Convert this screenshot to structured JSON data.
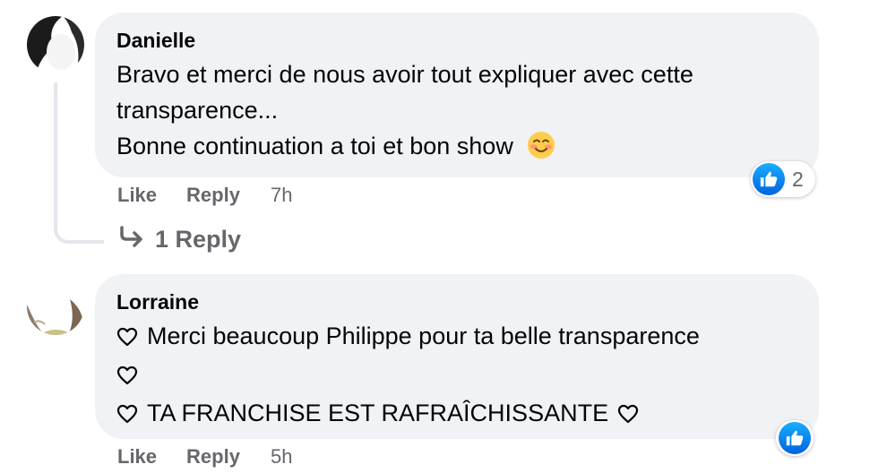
{
  "comments": [
    {
      "author": "Danielle",
      "lines": [
        "Bravo et merci de nous avoir tout expliquer avec cette",
        "transparence...",
        "Bonne continuation a toi et bon show"
      ],
      "emoji": "smiling-face-emoji",
      "like_label": "Like",
      "reply_label": "Reply",
      "time": "7h",
      "reaction_count": "2",
      "replies_label": "1 Reply"
    },
    {
      "author": "Lorraine",
      "lines": [
        "Merci beaucoup Philippe pour ta belle transparence",
        "",
        "TA FRANCHISE EST RAFRAÎCHISSANTE"
      ],
      "like_label": "Like",
      "reply_label": "Reply",
      "time": "5h"
    }
  ],
  "colors": {
    "bubble": "#f0f2f5",
    "meta_text": "#65676b",
    "like_blue": "#0866ff",
    "thread_line": "#e4e6eb"
  }
}
